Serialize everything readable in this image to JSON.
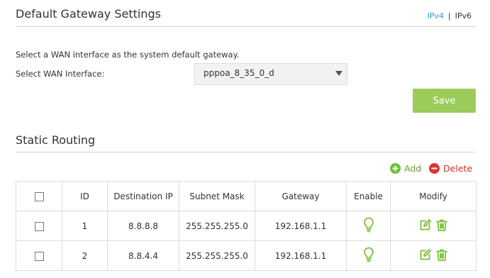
{
  "gateway": {
    "title": "Default Gateway Settings",
    "tabs": {
      "ipv4": "IPv4",
      "separator": "|",
      "ipv6": "IPv6"
    },
    "description": "Select a WAN interface as the system default gateway.",
    "wan_label": "Select WAN Interface:",
    "wan_value": "pppoa_8_35_0_d",
    "save_label": "Save"
  },
  "routing": {
    "title": "Static Routing",
    "add_label": "Add",
    "delete_label": "Delete",
    "columns": [
      "",
      "ID",
      "Destination IP",
      "Subnet Mask",
      "Gateway",
      "Enable",
      "Modify"
    ],
    "rows": [
      {
        "id": "1",
        "destination": "8.8.8.8",
        "mask": "255.255.255.0",
        "gateway": "192.168.1.1"
      },
      {
        "id": "2",
        "destination": "8.8.4.4",
        "mask": "255.255.255.0",
        "gateway": "192.168.1.1"
      }
    ]
  },
  "colors": {
    "accent_blue": "#2a9fd6",
    "green": "#7cbf3a",
    "save_bg": "#9bcb5a",
    "red": "#dd3333"
  },
  "icons": [
    "checkbox-icon",
    "add-icon",
    "delete-icon",
    "lightbulb-icon",
    "edit-icon",
    "trash-icon",
    "dropdown-caret-icon"
  ]
}
